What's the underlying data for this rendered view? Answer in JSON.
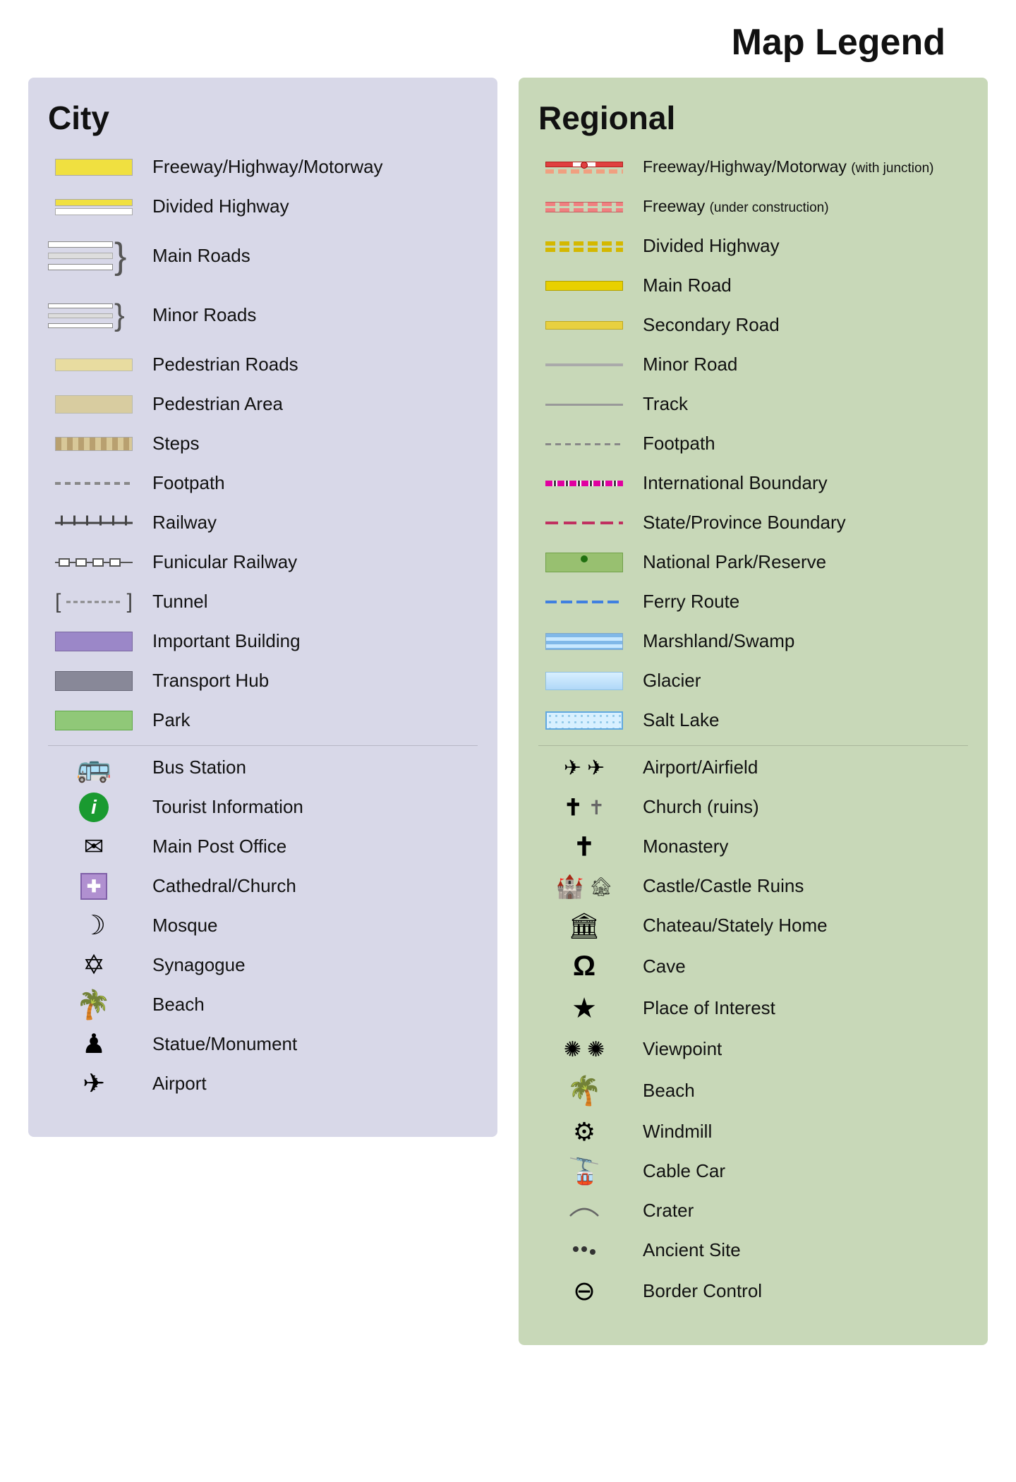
{
  "title": "Map Legend",
  "city": {
    "heading": "City",
    "items": [
      {
        "label": "Freeway/Highway/Motorway",
        "symbol": "freeway-yellow"
      },
      {
        "label": "Divided Highway",
        "symbol": "divided-highway"
      },
      {
        "label": "Main Roads",
        "symbol": "main-roads"
      },
      {
        "label": "Minor Roads",
        "symbol": "minor-roads"
      },
      {
        "label": "Pedestrian Roads",
        "symbol": "ped-roads"
      },
      {
        "label": "Pedestrian Area",
        "symbol": "ped-area"
      },
      {
        "label": "Steps",
        "symbol": "steps"
      },
      {
        "label": "Footpath",
        "symbol": "footpath"
      },
      {
        "label": "Railway",
        "symbol": "railway"
      },
      {
        "label": "Funicular Railway",
        "symbol": "funicular"
      },
      {
        "label": "Tunnel",
        "symbol": "tunnel"
      },
      {
        "label": "Important Building",
        "symbol": "important-bldg"
      },
      {
        "label": "Transport Hub",
        "symbol": "transport-hub"
      },
      {
        "label": "Park",
        "symbol": "park"
      },
      {
        "label": "Bus Station",
        "symbol": "bus-icon",
        "icon": "🚌"
      },
      {
        "label": "Tourist Information",
        "symbol": "tourist-icon",
        "icon": "ℹ"
      },
      {
        "label": "Main Post Office",
        "symbol": "post-icon",
        "icon": "✉"
      },
      {
        "label": "Cathedral/Church",
        "symbol": "church-icon",
        "icon": "✛"
      },
      {
        "label": "Mosque",
        "symbol": "mosque-icon",
        "icon": "☽"
      },
      {
        "label": "Synagogue",
        "symbol": "synagogue-icon",
        "icon": "✡"
      },
      {
        "label": "Beach",
        "symbol": "beach-icon",
        "icon": "🌴"
      },
      {
        "label": "Statue/Monument",
        "symbol": "statue-icon",
        "icon": "♟"
      },
      {
        "label": "Airport",
        "symbol": "airport-icon",
        "icon": "✈"
      }
    ]
  },
  "regional": {
    "heading": "Regional",
    "items": [
      {
        "label": "Freeway/Highway/Motorway (with junction)",
        "symbol": "reg-freeway"
      },
      {
        "label": "Freeway (under construction)",
        "symbol": "reg-freeway-uc"
      },
      {
        "label": "Divided Highway",
        "symbol": "reg-divided"
      },
      {
        "label": "Main Road",
        "symbol": "reg-main-road"
      },
      {
        "label": "Secondary Road",
        "symbol": "reg-secondary"
      },
      {
        "label": "Minor Road",
        "symbol": "reg-minor"
      },
      {
        "label": "Track",
        "symbol": "reg-track"
      },
      {
        "label": "Footpath",
        "symbol": "reg-footpath"
      },
      {
        "label": "International Boundary",
        "symbol": "reg-intl-boundary"
      },
      {
        "label": "State/Province Boundary",
        "symbol": "reg-state-boundary"
      },
      {
        "label": "National Park/Reserve",
        "symbol": "reg-natpark"
      },
      {
        "label": "Ferry Route",
        "symbol": "reg-ferry"
      },
      {
        "label": "Marshland/Swamp",
        "symbol": "reg-marsh"
      },
      {
        "label": "Glacier",
        "symbol": "reg-glacier"
      },
      {
        "label": "Salt Lake",
        "symbol": "reg-saltlake"
      },
      {
        "label": "Airport/Airfield",
        "symbol": "reg-airport",
        "icon": "✈✈"
      },
      {
        "label": "Church (ruins)",
        "symbol": "reg-church",
        "icon": "✝ ✝"
      },
      {
        "label": "Monastery",
        "symbol": "reg-monastery",
        "icon": "✝"
      },
      {
        "label": "Castle/Castle Ruins",
        "symbol": "reg-castle",
        "icon": "🏰"
      },
      {
        "label": "Chateau/Stately Home",
        "symbol": "reg-chateau",
        "icon": "🏛"
      },
      {
        "label": "Cave",
        "symbol": "reg-cave",
        "icon": "Ω"
      },
      {
        "label": "Place of Interest",
        "symbol": "reg-poi",
        "icon": "★"
      },
      {
        "label": "Viewpoint",
        "symbol": "reg-viewpoint",
        "icon": "✺ ✺"
      },
      {
        "label": "Beach",
        "symbol": "reg-beach",
        "icon": "🌴"
      },
      {
        "label": "Windmill",
        "symbol": "reg-windmill",
        "icon": "⚙"
      },
      {
        "label": "Cable Car",
        "symbol": "reg-cablecar",
        "icon": "🚡"
      },
      {
        "label": "Crater",
        "symbol": "reg-crater",
        "icon": "⌒"
      },
      {
        "label": "Ancient Site",
        "symbol": "reg-ancient",
        "icon": "⁘"
      },
      {
        "label": "Border Control",
        "symbol": "reg-border",
        "icon": "⊖"
      }
    ]
  }
}
